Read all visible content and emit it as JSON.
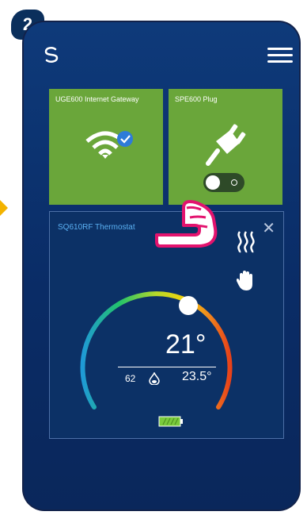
{
  "step": {
    "number": "2"
  },
  "tiles": [
    {
      "label": "UGE600 Internet Gateway",
      "icon": "wifi-check-icon"
    },
    {
      "label": "SPE600 Plug",
      "icon": "plug-icon"
    }
  ],
  "thermostat": {
    "title": "SQ610RF Thermostat",
    "close": "✕",
    "current_temp": "21°",
    "humidity": "62",
    "setpoint": "23.5°"
  },
  "colors": {
    "tile_green": "#6aa63a",
    "accent_pink": "#e3136e",
    "title_blue": "#5ab0f2"
  }
}
